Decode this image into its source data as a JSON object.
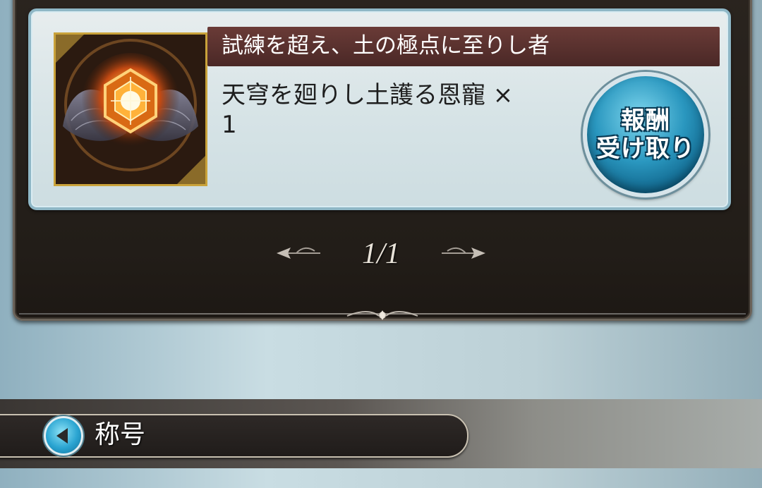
{
  "reward_card": {
    "title": "試練を超え、土の極点に至りし者",
    "item_name": "天穹を廻りし土護る恩寵 ×",
    "item_quantity": "1",
    "item_icon": "earth-crystal-wings-icon",
    "receive_button": {
      "line1": "報酬",
      "line2": "受け取り"
    }
  },
  "pager": {
    "label": "1/1",
    "prev_icon": "ornate-left-arrow-icon",
    "next_icon": "ornate-right-arrow-icon"
  },
  "section": {
    "title": "称号",
    "icon": "back-arrow-icon"
  },
  "colors": {
    "title_bar": "#5a302d",
    "button_blue": "#2a97bf",
    "frame_gold": "#c9a23a",
    "panel_dark": "#241e1a"
  }
}
